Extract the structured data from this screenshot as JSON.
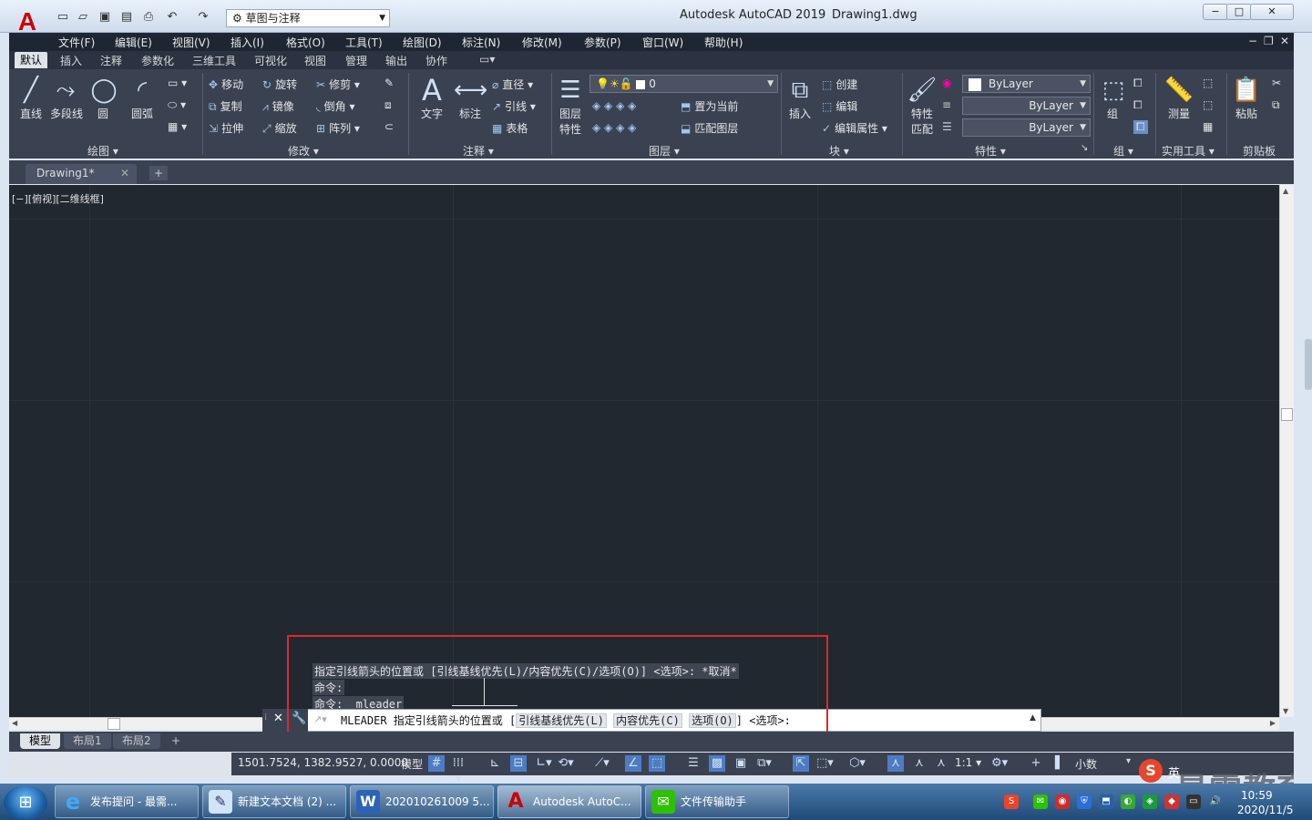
{
  "app": {
    "title": "Autodesk AutoCAD 2019",
    "document": "Drawing1.dwg",
    "workspace": "草图与注释",
    "logo": "A"
  },
  "menu": [
    "文件(F)",
    "编辑(E)",
    "视图(V)",
    "插入(I)",
    "格式(O)",
    "工具(T)",
    "绘图(D)",
    "标注(N)",
    "修改(M)",
    "参数(P)",
    "窗口(W)",
    "帮助(H)"
  ],
  "ribbon_tabs": [
    "默认",
    "插入",
    "注释",
    "参数化",
    "三维工具",
    "可视化",
    "视图",
    "管理",
    "输出",
    "协作"
  ],
  "ribbon": {
    "draw": {
      "line": "直线",
      "polyline": "多段线",
      "circle": "圆",
      "arc": "圆弧",
      "label": "绘图 ▾"
    },
    "modify": {
      "move": "移动",
      "rotate": "旋转",
      "trim": "修剪",
      "copy": "复制",
      "mirror": "镜像",
      "fillet": "倒角",
      "stretch": "拉伸",
      "scale": "缩放",
      "array": "阵列",
      "label": "修改 ▾"
    },
    "annotation": {
      "text": "文字",
      "dimension": "标注",
      "linear": "直径",
      "leader": "引线",
      "table": "表格",
      "label": "注释 ▾"
    },
    "layers": {
      "layer_props_1": "图层",
      "layer_props_2": "特性",
      "current_layer": "0",
      "set_current": "置为当前",
      "match_layer": "匹配图层",
      "label": "图层 ▾"
    },
    "block": {
      "insert": "插入",
      "create": "创建",
      "edit": "编辑",
      "edit_attr": "编辑属性",
      "label": "块 ▾"
    },
    "properties": {
      "match_1": "特性",
      "match_2": "匹配",
      "color": "ByLayer",
      "linetype": "ByLayer",
      "lineweight": "ByLayer",
      "label": "特性 ▾"
    },
    "groups": {
      "group": "组",
      "label": "组 ▾"
    },
    "utilities": {
      "measure": "测量",
      "label": "实用工具 ▾"
    },
    "clipboard": {
      "paste": "粘贴",
      "label": "剪贴板"
    }
  },
  "doc_tab": "Drawing1*",
  "viewport_label": "[−][俯视][二维线框]",
  "command": {
    "history": [
      "指定引线箭头的位置或 [引线基线优先(L)/内容优先(C)/选项(O)] <选项>: *取消*",
      "命令:",
      "命令: _mleader"
    ],
    "prompt_prefix": "MLEADER 指定引线箭头的位置或 [",
    "opt1": "引线基线优先(L)",
    "opt2": "内容优先(C)",
    "opt3": "选项(O)",
    "prompt_suffix": "] <选项>:"
  },
  "layout_tabs": [
    "模型",
    "布局1",
    "布局2",
    "+"
  ],
  "status": {
    "coords": "1501.7524, 1382.9527, 0.0000",
    "model": "模型",
    "scale": "1:1 ▾",
    "units": "小数"
  },
  "taskbar": {
    "items": [
      "发布提问 - 最需...",
      "新建文本文档 (2) ...",
      "202010261009 5...",
      "Autodesk AutoC...",
      "文件传输助手"
    ],
    "time": "10:59",
    "date": "2020/11/5"
  },
  "watermark": "最需教育",
  "ime": {
    "logo": "S",
    "mode": "英"
  },
  "colors": {
    "canvas": "#212830",
    "ribbon": "#3a4252",
    "highlight_box": "#e3262a",
    "taskbar": "#1f4a78"
  }
}
